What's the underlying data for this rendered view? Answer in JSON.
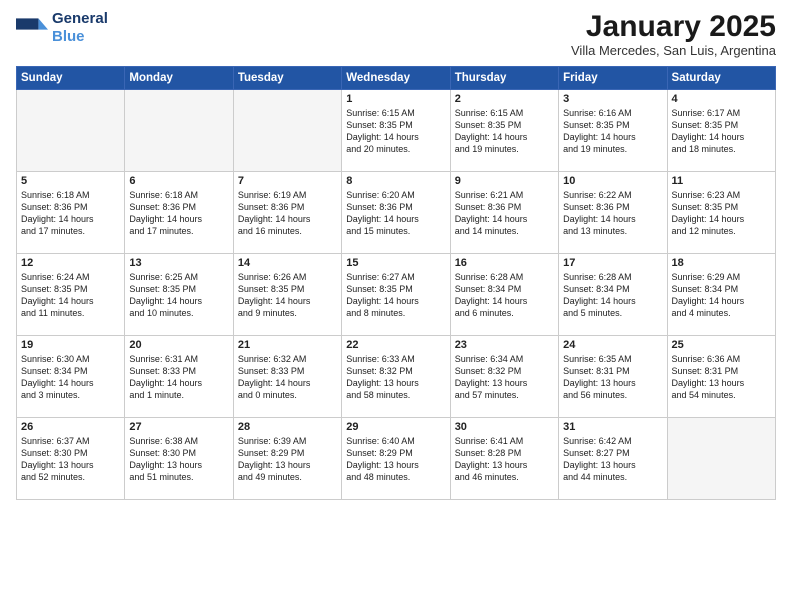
{
  "logo": {
    "line1": "General",
    "line2": "Blue"
  },
  "title": "January 2025",
  "subtitle": "Villa Mercedes, San Luis, Argentina",
  "header_days": [
    "Sunday",
    "Monday",
    "Tuesday",
    "Wednesday",
    "Thursday",
    "Friday",
    "Saturday"
  ],
  "weeks": [
    [
      {
        "day": "",
        "info": ""
      },
      {
        "day": "",
        "info": ""
      },
      {
        "day": "",
        "info": ""
      },
      {
        "day": "1",
        "info": "Sunrise: 6:15 AM\nSunset: 8:35 PM\nDaylight: 14 hours\nand 20 minutes."
      },
      {
        "day": "2",
        "info": "Sunrise: 6:15 AM\nSunset: 8:35 PM\nDaylight: 14 hours\nand 19 minutes."
      },
      {
        "day": "3",
        "info": "Sunrise: 6:16 AM\nSunset: 8:35 PM\nDaylight: 14 hours\nand 19 minutes."
      },
      {
        "day": "4",
        "info": "Sunrise: 6:17 AM\nSunset: 8:35 PM\nDaylight: 14 hours\nand 18 minutes."
      }
    ],
    [
      {
        "day": "5",
        "info": "Sunrise: 6:18 AM\nSunset: 8:36 PM\nDaylight: 14 hours\nand 17 minutes."
      },
      {
        "day": "6",
        "info": "Sunrise: 6:18 AM\nSunset: 8:36 PM\nDaylight: 14 hours\nand 17 minutes."
      },
      {
        "day": "7",
        "info": "Sunrise: 6:19 AM\nSunset: 8:36 PM\nDaylight: 14 hours\nand 16 minutes."
      },
      {
        "day": "8",
        "info": "Sunrise: 6:20 AM\nSunset: 8:36 PM\nDaylight: 14 hours\nand 15 minutes."
      },
      {
        "day": "9",
        "info": "Sunrise: 6:21 AM\nSunset: 8:36 PM\nDaylight: 14 hours\nand 14 minutes."
      },
      {
        "day": "10",
        "info": "Sunrise: 6:22 AM\nSunset: 8:36 PM\nDaylight: 14 hours\nand 13 minutes."
      },
      {
        "day": "11",
        "info": "Sunrise: 6:23 AM\nSunset: 8:35 PM\nDaylight: 14 hours\nand 12 minutes."
      }
    ],
    [
      {
        "day": "12",
        "info": "Sunrise: 6:24 AM\nSunset: 8:35 PM\nDaylight: 14 hours\nand 11 minutes."
      },
      {
        "day": "13",
        "info": "Sunrise: 6:25 AM\nSunset: 8:35 PM\nDaylight: 14 hours\nand 10 minutes."
      },
      {
        "day": "14",
        "info": "Sunrise: 6:26 AM\nSunset: 8:35 PM\nDaylight: 14 hours\nand 9 minutes."
      },
      {
        "day": "15",
        "info": "Sunrise: 6:27 AM\nSunset: 8:35 PM\nDaylight: 14 hours\nand 8 minutes."
      },
      {
        "day": "16",
        "info": "Sunrise: 6:28 AM\nSunset: 8:34 PM\nDaylight: 14 hours\nand 6 minutes."
      },
      {
        "day": "17",
        "info": "Sunrise: 6:28 AM\nSunset: 8:34 PM\nDaylight: 14 hours\nand 5 minutes."
      },
      {
        "day": "18",
        "info": "Sunrise: 6:29 AM\nSunset: 8:34 PM\nDaylight: 14 hours\nand 4 minutes."
      }
    ],
    [
      {
        "day": "19",
        "info": "Sunrise: 6:30 AM\nSunset: 8:34 PM\nDaylight: 14 hours\nand 3 minutes."
      },
      {
        "day": "20",
        "info": "Sunrise: 6:31 AM\nSunset: 8:33 PM\nDaylight: 14 hours\nand 1 minute."
      },
      {
        "day": "21",
        "info": "Sunrise: 6:32 AM\nSunset: 8:33 PM\nDaylight: 14 hours\nand 0 minutes."
      },
      {
        "day": "22",
        "info": "Sunrise: 6:33 AM\nSunset: 8:32 PM\nDaylight: 13 hours\nand 58 minutes."
      },
      {
        "day": "23",
        "info": "Sunrise: 6:34 AM\nSunset: 8:32 PM\nDaylight: 13 hours\nand 57 minutes."
      },
      {
        "day": "24",
        "info": "Sunrise: 6:35 AM\nSunset: 8:31 PM\nDaylight: 13 hours\nand 56 minutes."
      },
      {
        "day": "25",
        "info": "Sunrise: 6:36 AM\nSunset: 8:31 PM\nDaylight: 13 hours\nand 54 minutes."
      }
    ],
    [
      {
        "day": "26",
        "info": "Sunrise: 6:37 AM\nSunset: 8:30 PM\nDaylight: 13 hours\nand 52 minutes."
      },
      {
        "day": "27",
        "info": "Sunrise: 6:38 AM\nSunset: 8:30 PM\nDaylight: 13 hours\nand 51 minutes."
      },
      {
        "day": "28",
        "info": "Sunrise: 6:39 AM\nSunset: 8:29 PM\nDaylight: 13 hours\nand 49 minutes."
      },
      {
        "day": "29",
        "info": "Sunrise: 6:40 AM\nSunset: 8:29 PM\nDaylight: 13 hours\nand 48 minutes."
      },
      {
        "day": "30",
        "info": "Sunrise: 6:41 AM\nSunset: 8:28 PM\nDaylight: 13 hours\nand 46 minutes."
      },
      {
        "day": "31",
        "info": "Sunrise: 6:42 AM\nSunset: 8:27 PM\nDaylight: 13 hours\nand 44 minutes."
      },
      {
        "day": "",
        "info": ""
      }
    ]
  ]
}
